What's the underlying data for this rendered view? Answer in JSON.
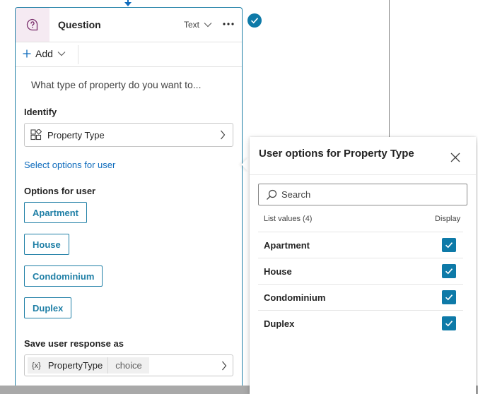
{
  "node": {
    "title": "Question",
    "response_type": "Text",
    "more_icon": "more-horizontal-icon",
    "add_label": "Add",
    "prompt_text": "What type of property do you want to...",
    "identify_label": "Identify",
    "identify_value": "Property Type",
    "select_options_link": "Select options for user",
    "options_label": "Options for user",
    "options": [
      "Apartment",
      "House",
      "Condominium",
      "Duplex"
    ],
    "save_label": "Save user response as",
    "variable_icon": "{x}",
    "variable_name": "PropertyType",
    "variable_type": "choice"
  },
  "panel": {
    "title": "User options for Property Type",
    "search_placeholder": "Search",
    "list_header": "List values (4)",
    "display_header": "Display",
    "items": [
      {
        "label": "Apartment",
        "checked": true
      },
      {
        "label": "House",
        "checked": true
      },
      {
        "label": "Condominium",
        "checked": true
      },
      {
        "label": "Duplex",
        "checked": true
      }
    ]
  },
  "colors": {
    "accent": "#0e7aa8",
    "link": "#0f6cbd",
    "icon_bg": "#f5eaf2"
  }
}
